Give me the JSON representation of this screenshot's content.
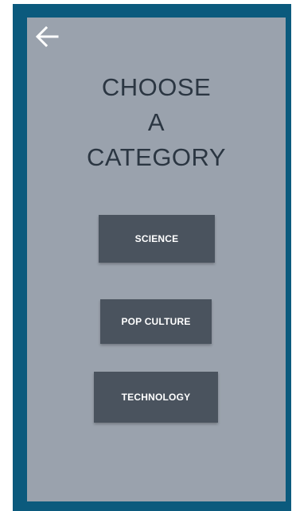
{
  "header": {
    "back_icon": "arrow-left-icon"
  },
  "title": {
    "line1": "CHOOSE",
    "line2": "A",
    "line3": "CATEGORY"
  },
  "categories": [
    {
      "label": "SCIENCE"
    },
    {
      "label": "POP CULTURE"
    },
    {
      "label": "TECHNOLOGY"
    }
  ],
  "colors": {
    "frame": "#0b5a7d",
    "background": "#9aa2ad",
    "button": "#4a535e",
    "title_text": "#2b3642"
  }
}
